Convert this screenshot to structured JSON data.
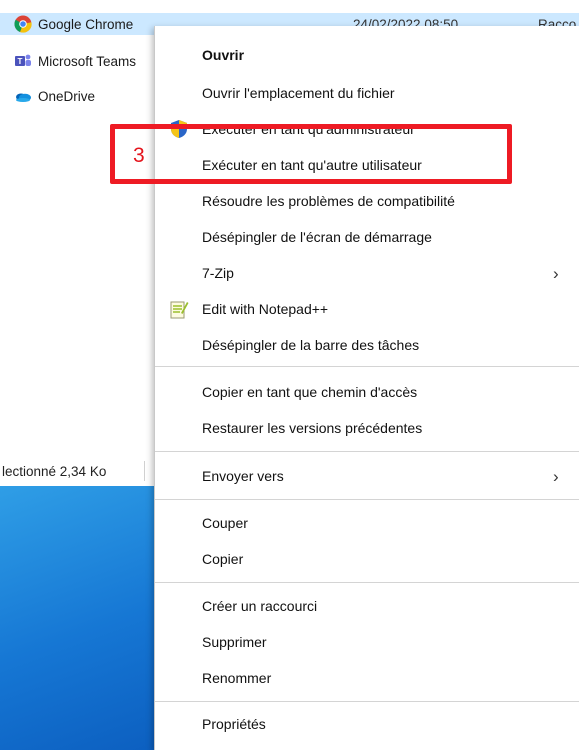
{
  "explorer": {
    "files": [
      {
        "name": "Google Chrome",
        "icon": "chrome-icon",
        "selected": true
      },
      {
        "name": "Microsoft Teams",
        "icon": "teams-icon",
        "selected": false
      },
      {
        "name": "OneDrive",
        "icon": "onedrive-icon",
        "selected": false
      }
    ],
    "chrome_date": "24/02/2022 08:50",
    "chrome_type": "Racco",
    "status_text": "lectionné 2,34 Ko"
  },
  "menu": {
    "items": [
      {
        "label": "Ouvrir"
      },
      {
        "label": "Ouvrir l'emplacement du fichier"
      },
      {
        "label": "Exécuter en tant qu'administrateur",
        "icon": "uac-shield-icon"
      },
      {
        "label": "Exécuter en tant qu'autre utilisateur"
      },
      {
        "label": "Résoudre les problèmes de compatibilité"
      },
      {
        "label": "Désépingler de l'écran de démarrage"
      },
      {
        "label": "7-Zip",
        "submenu": true
      },
      {
        "label": "Edit with Notepad++",
        "icon": "notepadpp-icon"
      },
      {
        "label": "Désépingler de la barre des tâches"
      },
      {
        "label": "Copier en tant que chemin d'accès"
      },
      {
        "label": "Restaurer les versions précédentes"
      },
      {
        "label": "Envoyer vers",
        "submenu": true
      },
      {
        "label": "Couper"
      },
      {
        "label": "Copier"
      },
      {
        "label": "Créer un raccourci"
      },
      {
        "label": "Supprimer"
      },
      {
        "label": "Renommer"
      },
      {
        "label": "Propriétés"
      }
    ],
    "submenu_arrow": "›"
  },
  "annotation": {
    "step_label": "3",
    "color": "#ee1b24"
  }
}
